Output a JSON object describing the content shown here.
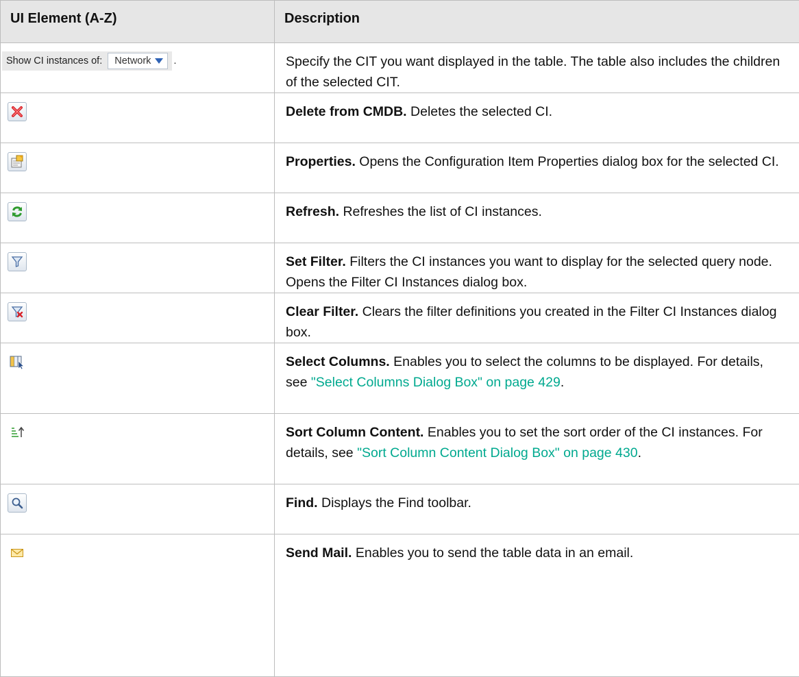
{
  "table": {
    "headers": [
      "UI Element (A-Z)",
      "Description"
    ],
    "show_control": {
      "label": "Show CI instances of:",
      "selected": "Network",
      "trailing": ".",
      "description": "Specify the CIT you want displayed in the table. The table also includes the children of the selected CIT."
    },
    "rows": [
      {
        "icon": "delete-x-icon",
        "title": "Delete from CMDB.",
        "text": " Deletes the selected CI."
      },
      {
        "icon": "properties-icon",
        "title": "Properties.",
        "text": " Opens the Configuration Item Properties dialog box for the selected CI."
      },
      {
        "icon": "refresh-icon",
        "title": "Refresh.",
        "text": " Refreshes the list of CI instances."
      },
      {
        "icon": "filter-icon",
        "title": "Set Filter.",
        "text": " Filters the CI instances you want to display for the selected query node. Opens the Filter CI Instances dialog box."
      },
      {
        "icon": "clear-filter-icon",
        "title": "Clear Filter.",
        "text": " Clears the filter definitions you created in the Filter CI Instances dialog box."
      },
      {
        "icon": "select-columns-icon",
        "title": "Select Columns.",
        "text": " Enables you to select the columns to be displayed. For details, see ",
        "link": "\"Select Columns Dialog Box\" on page 429",
        "after": "."
      },
      {
        "icon": "sort-icon",
        "title": "Sort Column Content.",
        "text": " Enables you to set the sort order of the CI instances. For details, see ",
        "link": "\"Sort Column Content Dialog Box\" on page 430",
        "after": "."
      },
      {
        "icon": "find-icon",
        "title": "Find.",
        "text": " Displays the Find toolbar."
      },
      {
        "icon": "mail-icon",
        "title": "Send Mail.",
        "text": " Enables you to send the table data in an email."
      }
    ]
  },
  "colors": {
    "header_bg": "#e6e6e6",
    "border": "#bdbdbd",
    "link": "#00a98f"
  }
}
